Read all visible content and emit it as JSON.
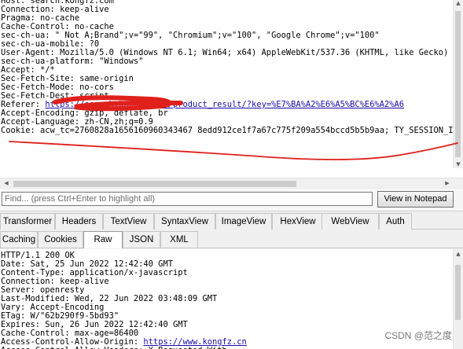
{
  "request": {
    "lines": [
      [
        {
          "t": "Host: search.kongfz.com"
        }
      ],
      [
        {
          "t": "Connection: keep-alive"
        }
      ],
      [
        {
          "t": "Pragma: no-cache"
        }
      ],
      [
        {
          "t": "Cache-Control: no-cache"
        }
      ],
      [
        {
          "t": "sec-ch-ua: \" Not A;Brand\";v=\"99\", \"Chromium\";v=\"100\", \"Google Chrome\";v=\"100\""
        }
      ],
      [
        {
          "t": "sec-ch-ua-mobile: ?0"
        }
      ],
      [
        {
          "t": "User-Agent: Mozilla/5.0 (Windows NT 6.1; Win64; x64) AppleWebKit/537.36 (KHTML, like Gecko)"
        }
      ],
      [
        {
          "t": "sec-ch-ua-platform: \"Windows\""
        }
      ],
      [
        {
          "t": "Accept: */*"
        }
      ],
      [
        {
          "t": "Sec-Fetch-Site: same-origin"
        }
      ],
      [
        {
          "t": "Sec-Fetch-Mode: no-cors"
        }
      ],
      [
        {
          "t": "Sec-Fetch-Dest: script"
        }
      ],
      [
        {
          "t": "Referer: "
        },
        {
          "t": "https://search.kongfz.com/product_result/?key=%E7%BA%A2%E6%A5%BC%E6%A2%A6",
          "link": true
        }
      ],
      [
        {
          "t": "Accept-Encoding: gzip, deflate, br"
        }
      ],
      [
        {
          "t": "Accept-Language: zh-CN,zh;q=0.9"
        }
      ],
      [
        {
          "t": "Cookie: acw_tc=2760828a1656160960343467 8edd912ce1f7a67c775f209a554bccd5b5b9aa; TY_SESSION_ID"
        }
      ]
    ]
  },
  "find_bar": {
    "placeholder": "Find... (press Ctrl+Enter to highlight all)",
    "button_label": "View in Notepad"
  },
  "inspector_tabs": {
    "row1": [
      "Transformer",
      "Headers",
      "TextView",
      "SyntaxView",
      "ImageView",
      "HexView",
      "WebView",
      "Auth"
    ],
    "row2": [
      "Caching",
      "Cookies",
      "Raw",
      "JSON",
      "XML"
    ],
    "active": "Raw"
  },
  "response": {
    "lines": [
      [
        {
          "t": "HTTP/1.1 200 OK"
        }
      ],
      [
        {
          "t": "Date: Sat, 25 Jun 2022 12:42:40 GMT"
        }
      ],
      [
        {
          "t": "Content-Type: application/x-javascript"
        }
      ],
      [
        {
          "t": "Connection: keep-alive"
        }
      ],
      [
        {
          "t": "Server: openresty"
        }
      ],
      [
        {
          "t": "Last-Modified: Wed, 22 Jun 2022 03:48:09 GMT"
        }
      ],
      [
        {
          "t": "Vary: Accept-Encoding"
        }
      ],
      [
        {
          "t": "ETag: W/\"62b290f9-5bd93\""
        }
      ],
      [
        {
          "t": "Expires: Sun, 26 Jun 2022 12:42:40 GMT"
        }
      ],
      [
        {
          "t": "Cache-Control: max-age=86400"
        }
      ],
      [
        {
          "t": "Access-Control-Allow-Origin: "
        },
        {
          "t": "https://www.kongfz.cn",
          "link": true
        }
      ],
      [
        {
          "t": "Access-Control-Allow-Headers: X-Requested-With"
        }
      ]
    ]
  },
  "watermark": "CSDN @范之度",
  "colors": {
    "annotation": "#e0201b",
    "link": "#1a0dab"
  }
}
